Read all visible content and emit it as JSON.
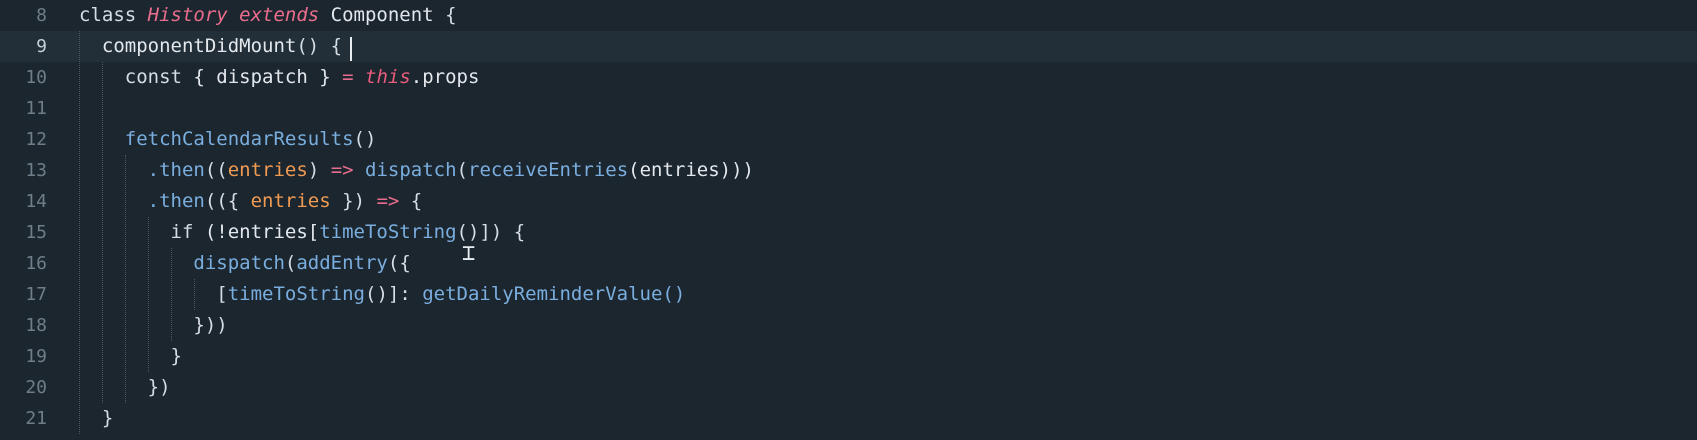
{
  "editor": {
    "lines": [
      {
        "number": "8",
        "tokens": [
          {
            "t": "class ",
            "c": "kw"
          },
          {
            "t": "History",
            "c": "cls"
          },
          {
            "t": " extends ",
            "c": "cls"
          },
          {
            "t": "Component",
            "c": "plain"
          },
          {
            "t": " {",
            "c": "punc"
          }
        ]
      },
      {
        "number": "9",
        "active": true,
        "tokens": [
          {
            "t": "  componentDidMount",
            "c": "plain"
          },
          {
            "t": "() {",
            "c": "punc"
          }
        ]
      },
      {
        "number": "10",
        "tokens": [
          {
            "t": "    const ",
            "c": "kw"
          },
          {
            "t": "{ dispatch } ",
            "c": "plain"
          },
          {
            "t": "= ",
            "c": "op"
          },
          {
            "t": "this",
            "c": "this"
          },
          {
            "t": ".props",
            "c": "plain"
          }
        ]
      },
      {
        "number": "11",
        "tokens": []
      },
      {
        "number": "12",
        "tokens": [
          {
            "t": "    fetchCalendarResults",
            "c": "fn"
          },
          {
            "t": "()",
            "c": "punc"
          }
        ]
      },
      {
        "number": "13",
        "tokens": [
          {
            "t": "      .then",
            "c": "fn"
          },
          {
            "t": "((",
            "c": "punc"
          },
          {
            "t": "entries",
            "c": "param"
          },
          {
            "t": ") ",
            "c": "punc"
          },
          {
            "t": "=> ",
            "c": "op"
          },
          {
            "t": "dispatch",
            "c": "fn"
          },
          {
            "t": "(",
            "c": "punc"
          },
          {
            "t": "receiveEntries",
            "c": "fn"
          },
          {
            "t": "(entries)))",
            "c": "plain"
          }
        ]
      },
      {
        "number": "14",
        "tokens": [
          {
            "t": "      .then",
            "c": "fn"
          },
          {
            "t": "(({ ",
            "c": "punc"
          },
          {
            "t": "entries",
            "c": "param"
          },
          {
            "t": " }) ",
            "c": "punc"
          },
          {
            "t": "=> ",
            "c": "op"
          },
          {
            "t": "{",
            "c": "punc"
          }
        ]
      },
      {
        "number": "15",
        "tokens": [
          {
            "t": "        if ",
            "c": "kw"
          },
          {
            "t": "(!entries[",
            "c": "plain"
          },
          {
            "t": "timeToString",
            "c": "fn"
          },
          {
            "t": "()]) {",
            "c": "punc"
          }
        ]
      },
      {
        "number": "16",
        "tokens": [
          {
            "t": "          dispatch",
            "c": "fn"
          },
          {
            "t": "(",
            "c": "punc"
          },
          {
            "t": "addEntry",
            "c": "fn"
          },
          {
            "t": "({",
            "c": "punc"
          }
        ]
      },
      {
        "number": "17",
        "tokens": [
          {
            "t": "            [",
            "c": "punc"
          },
          {
            "t": "timeToString",
            "c": "fn"
          },
          {
            "t": "()]: ",
            "c": "punc"
          },
          {
            "t": "getDailyReminderValue",
            "c": "fn"
          },
          {
            "t": "()",
            "c": "fn"
          }
        ]
      },
      {
        "number": "18",
        "tokens": [
          {
            "t": "          }))",
            "c": "punc"
          }
        ]
      },
      {
        "number": "19",
        "tokens": [
          {
            "t": "        }",
            "c": "punc"
          }
        ]
      },
      {
        "number": "20",
        "tokens": [
          {
            "t": "      })",
            "c": "punc"
          }
        ]
      },
      {
        "number": "21",
        "tokens": [
          {
            "t": "  }",
            "c": "punc"
          }
        ]
      }
    ],
    "colors": {
      "background": "#1c262f",
      "active_line": "#222e38",
      "function": "#7aaedf",
      "keyword_italic": "#e96d8c",
      "parameter": "#f09a52",
      "text": "#e3e8ec",
      "line_number": "#6f7d88"
    },
    "cursor_icon": "text-cursor-icon"
  }
}
